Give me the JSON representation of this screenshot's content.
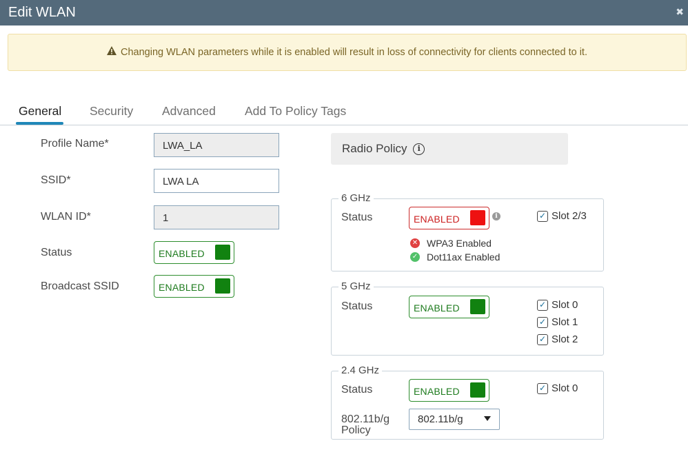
{
  "window": {
    "title": "Edit WLAN",
    "close_glyph": "✖"
  },
  "warning": {
    "icon": "warning-icon",
    "text": "Changing WLAN parameters while it is enabled will result in loss of connectivity for clients connected to it."
  },
  "tabs": [
    {
      "label": "General",
      "active": true
    },
    {
      "label": "Security",
      "active": false
    },
    {
      "label": "Advanced",
      "active": false
    },
    {
      "label": "Add To Policy Tags",
      "active": false
    }
  ],
  "general": {
    "profile_name": {
      "label": "Profile Name*",
      "value": "LWA_LA"
    },
    "ssid": {
      "label": "SSID*",
      "value": "LWA LA"
    },
    "wlan_id": {
      "label": "WLAN ID*",
      "value": "1"
    },
    "status": {
      "label": "Status",
      "toggle": "ENABLED"
    },
    "broadcast_ssid": {
      "label": "Broadcast SSID",
      "toggle": "ENABLED"
    }
  },
  "radio_policy": {
    "title": "Radio Policy",
    "info_glyph": "i",
    "band_6ghz": {
      "legend": "6 GHz",
      "status_label": "Status",
      "toggle": "ENABLED",
      "toggle_color": "#ee1111",
      "info_glyph": "i",
      "slots": [
        {
          "label": "Slot 2/3",
          "checked": true
        }
      ],
      "requirements": [
        {
          "text": "WPA3 Enabled",
          "ok": false,
          "glyph": "✕"
        },
        {
          "text": "Dot11ax Enabled",
          "ok": true,
          "glyph": "✓"
        }
      ]
    },
    "band_5ghz": {
      "legend": "5 GHz",
      "status_label": "Status",
      "toggle": "ENABLED",
      "slots": [
        {
          "label": "Slot 0",
          "checked": true
        },
        {
          "label": "Slot 1",
          "checked": true
        },
        {
          "label": "Slot 2",
          "checked": true
        }
      ]
    },
    "band_24ghz": {
      "legend": "2.4 GHz",
      "status_label": "Status",
      "toggle": "ENABLED",
      "slots": [
        {
          "label": "Slot 0",
          "checked": true
        }
      ],
      "policy_label_line1": "802.11b/g",
      "policy_label_line2": "Policy",
      "policy_value": "802.11b/g"
    }
  },
  "colors": {
    "header": "#546a7b",
    "accent": "#1f87b8",
    "enabled_green": "#118210",
    "disabled_red": "#ee1111"
  },
  "check_glyph": "✓"
}
